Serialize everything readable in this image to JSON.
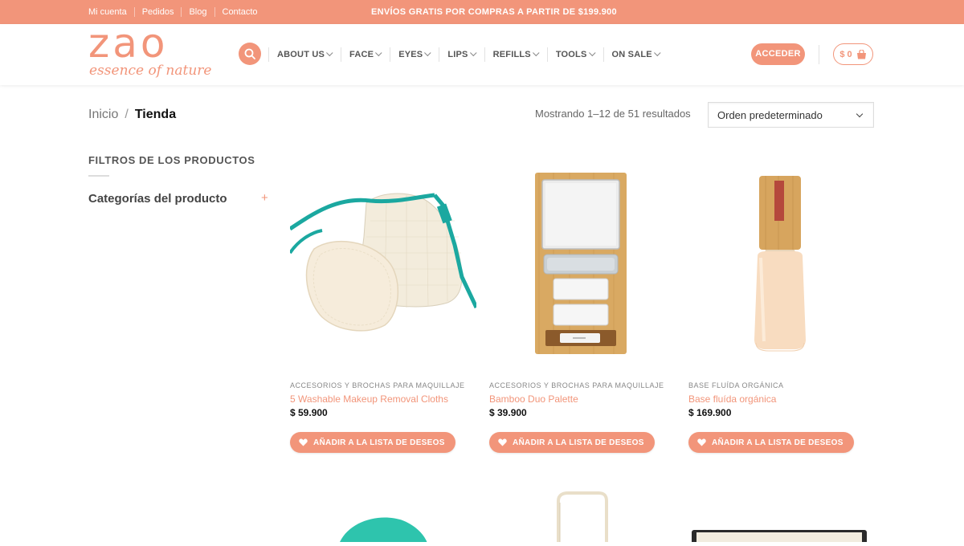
{
  "topbar": {
    "links": [
      "Mi cuenta",
      "Pedidos",
      "Blog",
      "Contacto"
    ],
    "promo": "ENVÍOS GRATIS POR COMPRAS A PARTIR DE $199.900"
  },
  "header": {
    "logo_word": "zao",
    "logo_tagline": "essence of nature",
    "nav": [
      "ABOUT US",
      "FACE",
      "EYES",
      "LIPS",
      "REFILLS",
      "TOOLS",
      "ON SALE"
    ],
    "login_label": "ACCEDER",
    "cart_label": "$ 0"
  },
  "breadcrumb": {
    "home": "Inicio",
    "separator": "/",
    "current": "Tienda"
  },
  "results_text": "Mostrando 1–12 de 51 resultados",
  "sort": {
    "selected": "Orden predeterminado"
  },
  "sidebar": {
    "title": "FILTROS DE LOS PRODUCTOS",
    "categories_label": "Categorías del producto",
    "expand_symbol": "+"
  },
  "products": [
    {
      "category": "ACCESORIOS Y BROCHAS PARA MAQUILLAJE",
      "name": "5 Washable Makeup Removal Cloths",
      "price": "$ 59.900",
      "wishlist_label": "AÑADIR A LA LISTA DE DESEOS"
    },
    {
      "category": "ACCESORIOS Y BROCHAS PARA MAQUILLAJE",
      "name": "Bamboo Duo Palette",
      "price": "$ 39.900",
      "wishlist_label": "AÑADIR A LA LISTA DE DESEOS"
    },
    {
      "category": "BASE FLUÍDA ORGÁNICA",
      "name": "Base fluída orgánica",
      "price": "$ 169.900",
      "wishlist_label": "AÑADIR A LA LISTA DE DESEOS"
    }
  ],
  "colors": {
    "accent": "#f2957a",
    "teal": "#1ba8a0",
    "bamboo": "#d9a962"
  },
  "icons": {
    "search": "search-icon",
    "cart": "shopping-bag-icon",
    "wishlist": "heart-icon"
  }
}
